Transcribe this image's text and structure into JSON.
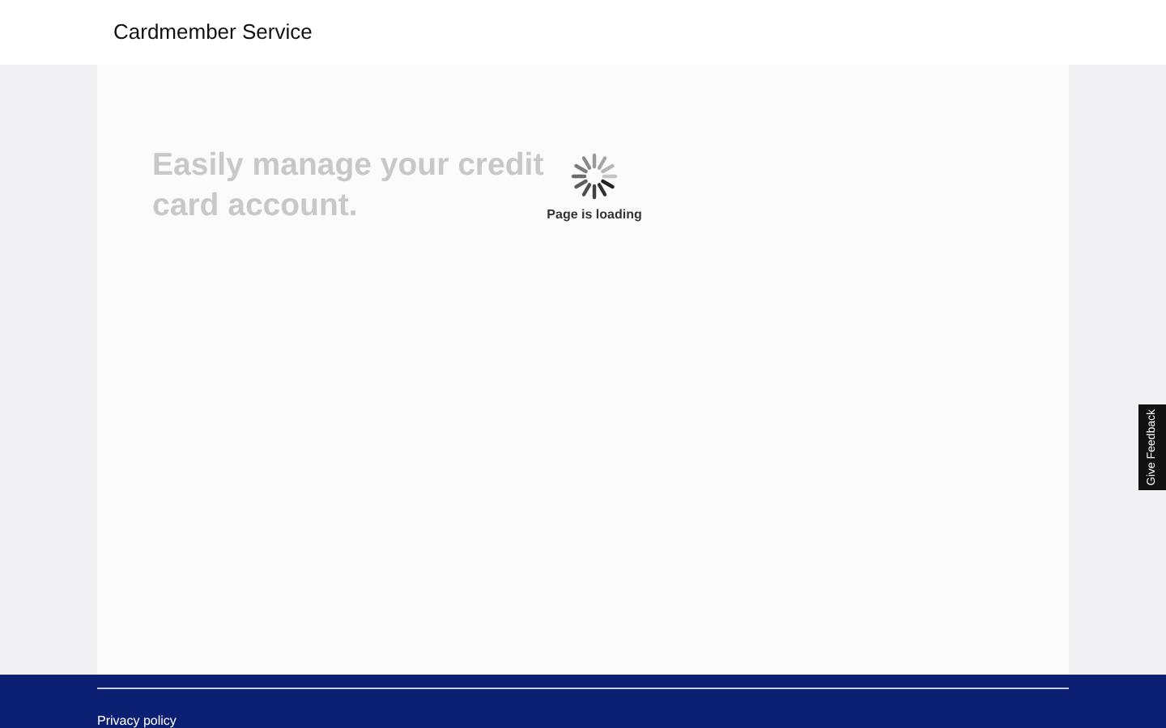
{
  "header": {
    "title": "Cardmember Service"
  },
  "main": {
    "headline": "Easily manage your credit card account.",
    "loading_text": "Page is loading"
  },
  "feedback_tab": {
    "label": "Give Feedback"
  },
  "footer": {
    "links": [
      "Privacy policy"
    ]
  }
}
